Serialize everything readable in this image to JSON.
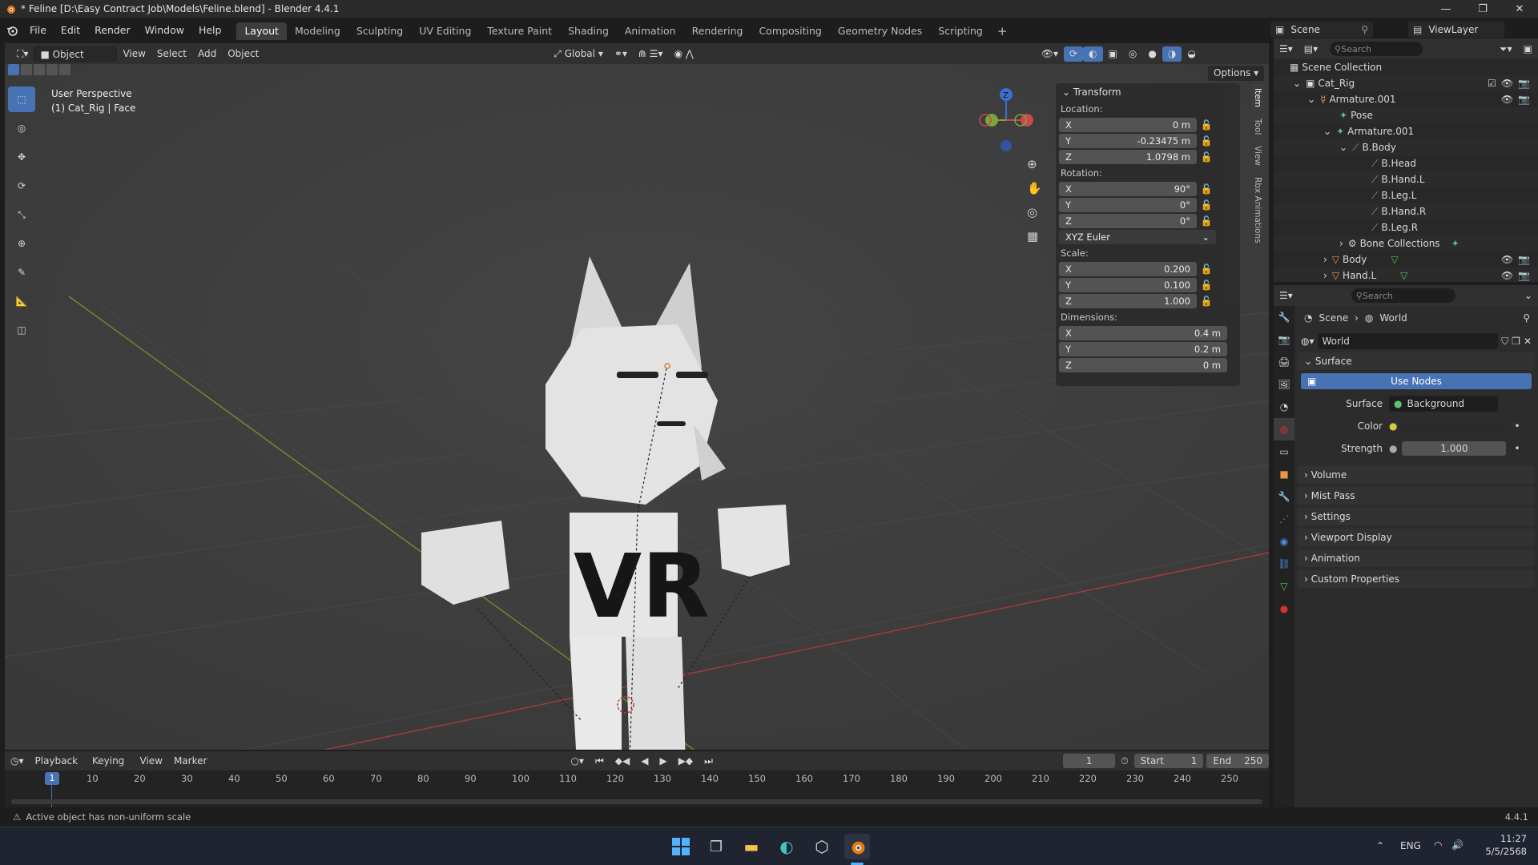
{
  "window": {
    "title": "* Feline [D:\\Easy Contract Job\\Models\\Feline.blend] - Blender 4.4.1"
  },
  "menu": {
    "items": [
      "File",
      "Edit",
      "Render",
      "Window",
      "Help"
    ]
  },
  "workspaces": [
    "Layout",
    "Modeling",
    "Sculpting",
    "UV Editing",
    "Texture Paint",
    "Shading",
    "Animation",
    "Rendering",
    "Compositing",
    "Geometry Nodes",
    "Scripting"
  ],
  "scene": {
    "name": "Scene",
    "view_layer": "ViewLayer"
  },
  "viewport_header": {
    "mode": "Object Mode",
    "view": "View",
    "select": "Select",
    "add": "Add",
    "object": "Object",
    "orientation": "Global",
    "options": "Options"
  },
  "viewport": {
    "perspective": "User Perspective",
    "active": "(1) Cat_Rig | Face",
    "model_text": "VR"
  },
  "npanel": {
    "tabs": [
      "Item",
      "Tool",
      "View",
      "Rbx Animations"
    ],
    "title": "Transform",
    "location_label": "Location:",
    "location": {
      "x": "0 m",
      "y": "-0.23475 m",
      "z": "1.0798 m"
    },
    "rotation_label": "Rotation:",
    "rotation": {
      "x": "90°",
      "y": "0°",
      "z": "0°"
    },
    "rotation_mode": "XYZ Euler",
    "scale_label": "Scale:",
    "scale": {
      "x": "0.200",
      "y": "0.100",
      "z": "1.000"
    },
    "dimensions_label": "Dimensions:",
    "dimensions": {
      "x": "0.4 m",
      "y": "0.2 m",
      "z": "0 m"
    },
    "axis": {
      "x": "X",
      "y": "Y",
      "z": "Z"
    }
  },
  "outliner": {
    "search_placeholder": "Search",
    "rows": [
      {
        "label": "Scene Collection"
      },
      {
        "label": "Cat_Rig"
      },
      {
        "label": "Armature.001"
      },
      {
        "label": "Pose"
      },
      {
        "label": "Armature.001"
      },
      {
        "label": "B.Body"
      },
      {
        "label": "B.Head"
      },
      {
        "label": "B.Hand.L"
      },
      {
        "label": "B.Leg.L"
      },
      {
        "label": "B.Hand.R"
      },
      {
        "label": "B.Leg.R"
      },
      {
        "label": "Bone Collections"
      },
      {
        "label": "Body"
      },
      {
        "label": "Hand.L"
      }
    ]
  },
  "properties": {
    "search_placeholder": "Search",
    "breadcrumb_scene": "Scene",
    "breadcrumb_world": "World",
    "world_name": "World",
    "surface_section": "Surface",
    "use_nodes": "Use Nodes",
    "surface_label": "Surface",
    "surface_value": "Background",
    "color_label": "Color",
    "strength_label": "Strength",
    "strength_value": "1.000",
    "sections": [
      "Volume",
      "Mist Pass",
      "Settings",
      "Viewport Display",
      "Animation",
      "Custom Properties"
    ]
  },
  "timeline": {
    "playback": "Playback",
    "keying": "Keying",
    "view": "View",
    "marker": "Marker",
    "current_frame": "1",
    "start_label": "Start",
    "start": "1",
    "end_label": "End",
    "end": "250",
    "ticks": [
      "10",
      "20",
      "30",
      "40",
      "50",
      "60",
      "70",
      "80",
      "90",
      "100",
      "110",
      "120",
      "130",
      "140",
      "150",
      "160",
      "170",
      "180",
      "190",
      "200",
      "210",
      "220",
      "230",
      "240",
      "250"
    ],
    "playhead": "1"
  },
  "status": {
    "message": "Active object has non-uniform scale",
    "version": "4.4.1"
  },
  "taskbar": {
    "lang": "ENG",
    "time": "11:27",
    "date": "5/5/2568"
  },
  "colors": {
    "accent": "#4772b3",
    "axis_x": "#c94a4a",
    "axis_y": "#7aa63c",
    "axis_z": "#3b6fd0"
  }
}
